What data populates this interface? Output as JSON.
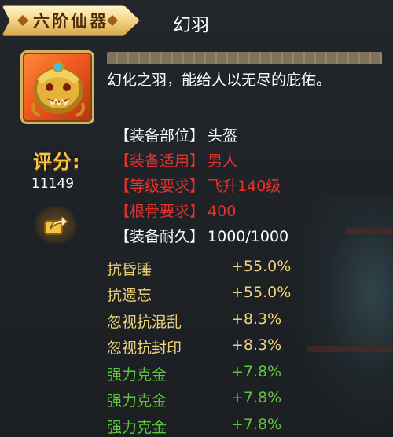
{
  "header": {
    "rank": "六阶仙器",
    "item_name": "幻羽"
  },
  "item": {
    "icon": "golden-lion-helmet-icon",
    "description": "幻化之羽，能给人以无尽的庇佑。"
  },
  "score": {
    "label": "评分:",
    "value": "11149"
  },
  "share_icon": "share-arrow-icon",
  "attributes": [
    {
      "key": "【装备部位】",
      "value": "头盔",
      "color": "#ffffff"
    },
    {
      "key": "【装备适用】",
      "value": "男人",
      "color": "#e8312a"
    },
    {
      "key": "【等级要求】",
      "value": "飞升140级",
      "color": "#e8312a"
    },
    {
      "key": "【根骨要求】",
      "value": "400",
      "color": "#e8312a"
    },
    {
      "key": "【装备耐久】",
      "value": "1000/1000",
      "color": "#ffffff"
    }
  ],
  "bonuses": [
    {
      "name": "抗昏睡",
      "value": "+55.0%",
      "color": "#f0d27a"
    },
    {
      "name": "抗遗忘",
      "value": "+55.0%",
      "color": "#f0d27a"
    },
    {
      "name": "忽视抗混乱",
      "value": "+8.3%",
      "color": "#f0d27a"
    },
    {
      "name": "忽视抗封印",
      "value": "+8.3%",
      "color": "#f0d27a"
    },
    {
      "name": "强力克金",
      "value": "+7.8%",
      "color": "#5fc73a"
    },
    {
      "name": "强力克金",
      "value": "+7.8%",
      "color": "#5fc73a"
    },
    {
      "name": "强力克金",
      "value": "+7.8%",
      "color": "#5fc73a"
    }
  ]
}
